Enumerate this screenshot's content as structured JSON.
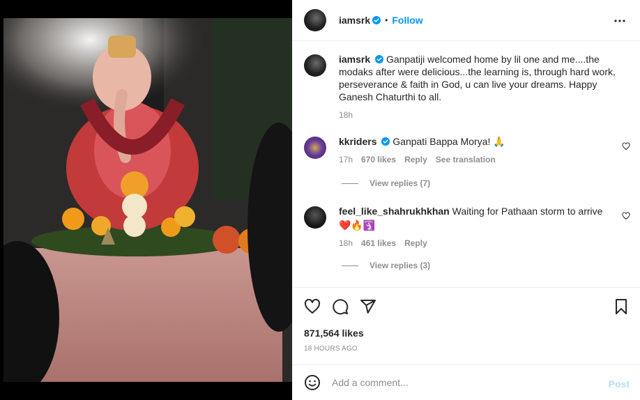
{
  "post": {
    "username": "iamsrk",
    "follow_label": "Follow",
    "dot": "•",
    "caption": "Ganpatiji welcomed home by lil one and me....the modaks after were delicious...the learning is, through hard work, perseverance & faith in God, u can live your dreams. Happy Ganesh Chaturthi to all.",
    "caption_time": "18h",
    "likes": "871,564 likes",
    "timestamp": "18 HOURS AGO"
  },
  "comments": [
    {
      "username": "kkriders",
      "text": "Ganpati Bappa Morya! 🙏",
      "time": "17h",
      "likes": "670 likes",
      "reply_label": "Reply",
      "translation_label": "See translation",
      "view_replies": "View replies (7)"
    },
    {
      "username": "feel_like_shahrukhkhan",
      "text": "Waiting for Pathaan storm to arrive",
      "emojis": "❤️🔥🛐",
      "time": "18h",
      "likes": "461 likes",
      "reply_label": "Reply",
      "view_replies": "View replies (3)"
    }
  ],
  "add_comment": {
    "placeholder": "Add a comment...",
    "post_label": "Post"
  },
  "colors": {
    "accent": "#0095f6",
    "post_disabled": "#b2dffc",
    "muted": "#8e8e8e",
    "like_heart": "#ed4956"
  }
}
